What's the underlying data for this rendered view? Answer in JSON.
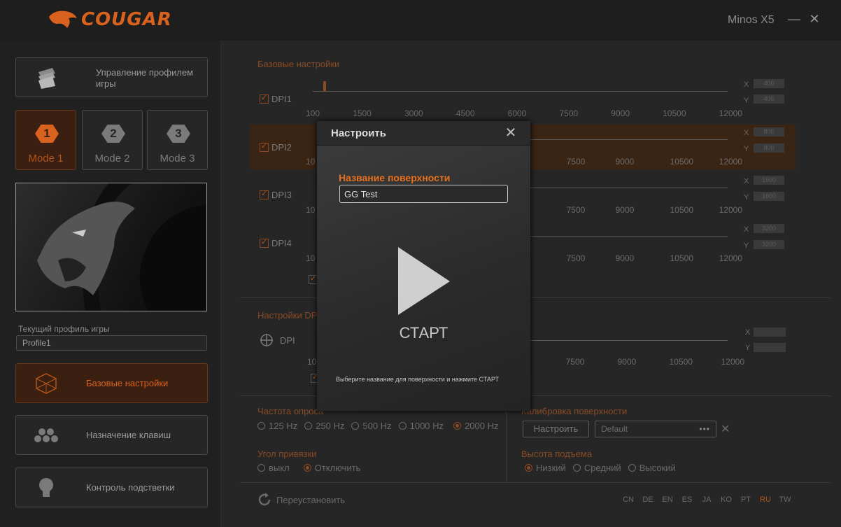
{
  "app": {
    "brand": "COUGAR",
    "device": "Minos X5"
  },
  "sidebar": {
    "profile_manager": "Управление профилем игры",
    "modes": [
      "Mode 1",
      "Mode 2",
      "Mode 3"
    ],
    "mode_numbers": [
      "1",
      "2",
      "3"
    ],
    "current_profile_label": "Текущий профиль игры",
    "current_profile": "Profile1",
    "nav": [
      {
        "label": "Базовые настройки",
        "icon": "cube-icon",
        "active": true
      },
      {
        "label": "Назначение клавиш",
        "icon": "buttons-icon",
        "active": false
      },
      {
        "label": "Контроль подстветки",
        "icon": "bulb-icon",
        "active": false
      }
    ]
  },
  "main": {
    "basic_settings_title": "Базовые настройки",
    "dpi_rows": [
      {
        "label": "DPI1",
        "x": "400",
        "y": "400"
      },
      {
        "label": "DPI2",
        "x": "800",
        "y": "800"
      },
      {
        "label": "DPI3",
        "x": "1600",
        "y": "1600"
      },
      {
        "label": "DPI4",
        "x": "3200",
        "y": "3200"
      }
    ],
    "ticks_full": [
      "100",
      "1500",
      "3000",
      "4500",
      "6000",
      "7500",
      "9000",
      "10500",
      "12000"
    ],
    "ticks_partial": [
      "10",
      "7500",
      "9000",
      "10500",
      "12000"
    ],
    "axis_x": "X",
    "axis_y": "Y",
    "dpi_settings_title": "Настройки DPI",
    "dpi_single_label": "DPI",
    "dpi_single_ticks": [
      "10",
      "0",
      "7500",
      "9000",
      "10500",
      "12000"
    ],
    "polling_title": "Частота опроса",
    "polling_options": [
      "125 Hz",
      "250 Hz",
      "500 Hz",
      "1000 Hz",
      "2000 Hz"
    ],
    "polling_selected": "2000 Hz",
    "angle_title": "Угол привязки",
    "angle_options": [
      "выкл",
      "Отключить"
    ],
    "angle_selected": "Отключить",
    "calibration_title": "Калибровка поверхности",
    "calibrate_button": "Настроить",
    "calibration_value": "Default",
    "calibration_more": "•••",
    "lift_title": "Высота подъема",
    "lift_options": [
      "Низкий",
      "Средний",
      "Высокий"
    ],
    "lift_selected": "Низкий",
    "reset": "Переустановить",
    "languages": [
      "CN",
      "DE",
      "EN",
      "ES",
      "JA",
      "KO",
      "PT",
      "RU",
      "TW"
    ],
    "language_selected": "RU"
  },
  "modal": {
    "title": "Настроить",
    "surface_label": "Название поверхности",
    "surface_value": "GG Test",
    "start_label": "СТАРТ",
    "hint": "Выберите название для поверхности и нажмите СТАРТ"
  },
  "colors": {
    "accent": "#d9621e",
    "background": "#262626",
    "text": "#9a9a9a"
  }
}
